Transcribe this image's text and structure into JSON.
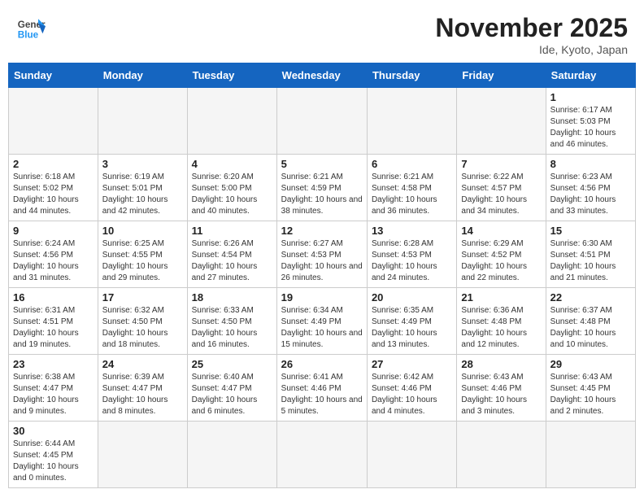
{
  "header": {
    "logo_general": "General",
    "logo_blue": "Blue",
    "title": "November 2025",
    "location": "Ide, Kyoto, Japan"
  },
  "days_of_week": [
    "Sunday",
    "Monday",
    "Tuesday",
    "Wednesday",
    "Thursday",
    "Friday",
    "Saturday"
  ],
  "weeks": [
    [
      {
        "day": "",
        "info": ""
      },
      {
        "day": "",
        "info": ""
      },
      {
        "day": "",
        "info": ""
      },
      {
        "day": "",
        "info": ""
      },
      {
        "day": "",
        "info": ""
      },
      {
        "day": "",
        "info": ""
      },
      {
        "day": "1",
        "info": "Sunrise: 6:17 AM\nSunset: 5:03 PM\nDaylight: 10 hours and 46 minutes."
      }
    ],
    [
      {
        "day": "2",
        "info": "Sunrise: 6:18 AM\nSunset: 5:02 PM\nDaylight: 10 hours and 44 minutes."
      },
      {
        "day": "3",
        "info": "Sunrise: 6:19 AM\nSunset: 5:01 PM\nDaylight: 10 hours and 42 minutes."
      },
      {
        "day": "4",
        "info": "Sunrise: 6:20 AM\nSunset: 5:00 PM\nDaylight: 10 hours and 40 minutes."
      },
      {
        "day": "5",
        "info": "Sunrise: 6:21 AM\nSunset: 4:59 PM\nDaylight: 10 hours and 38 minutes."
      },
      {
        "day": "6",
        "info": "Sunrise: 6:21 AM\nSunset: 4:58 PM\nDaylight: 10 hours and 36 minutes."
      },
      {
        "day": "7",
        "info": "Sunrise: 6:22 AM\nSunset: 4:57 PM\nDaylight: 10 hours and 34 minutes."
      },
      {
        "day": "8",
        "info": "Sunrise: 6:23 AM\nSunset: 4:56 PM\nDaylight: 10 hours and 33 minutes."
      }
    ],
    [
      {
        "day": "9",
        "info": "Sunrise: 6:24 AM\nSunset: 4:56 PM\nDaylight: 10 hours and 31 minutes."
      },
      {
        "day": "10",
        "info": "Sunrise: 6:25 AM\nSunset: 4:55 PM\nDaylight: 10 hours and 29 minutes."
      },
      {
        "day": "11",
        "info": "Sunrise: 6:26 AM\nSunset: 4:54 PM\nDaylight: 10 hours and 27 minutes."
      },
      {
        "day": "12",
        "info": "Sunrise: 6:27 AM\nSunset: 4:53 PM\nDaylight: 10 hours and 26 minutes."
      },
      {
        "day": "13",
        "info": "Sunrise: 6:28 AM\nSunset: 4:53 PM\nDaylight: 10 hours and 24 minutes."
      },
      {
        "day": "14",
        "info": "Sunrise: 6:29 AM\nSunset: 4:52 PM\nDaylight: 10 hours and 22 minutes."
      },
      {
        "day": "15",
        "info": "Sunrise: 6:30 AM\nSunset: 4:51 PM\nDaylight: 10 hours and 21 minutes."
      }
    ],
    [
      {
        "day": "16",
        "info": "Sunrise: 6:31 AM\nSunset: 4:51 PM\nDaylight: 10 hours and 19 minutes."
      },
      {
        "day": "17",
        "info": "Sunrise: 6:32 AM\nSunset: 4:50 PM\nDaylight: 10 hours and 18 minutes."
      },
      {
        "day": "18",
        "info": "Sunrise: 6:33 AM\nSunset: 4:50 PM\nDaylight: 10 hours and 16 minutes."
      },
      {
        "day": "19",
        "info": "Sunrise: 6:34 AM\nSunset: 4:49 PM\nDaylight: 10 hours and 15 minutes."
      },
      {
        "day": "20",
        "info": "Sunrise: 6:35 AM\nSunset: 4:49 PM\nDaylight: 10 hours and 13 minutes."
      },
      {
        "day": "21",
        "info": "Sunrise: 6:36 AM\nSunset: 4:48 PM\nDaylight: 10 hours and 12 minutes."
      },
      {
        "day": "22",
        "info": "Sunrise: 6:37 AM\nSunset: 4:48 PM\nDaylight: 10 hours and 10 minutes."
      }
    ],
    [
      {
        "day": "23",
        "info": "Sunrise: 6:38 AM\nSunset: 4:47 PM\nDaylight: 10 hours and 9 minutes."
      },
      {
        "day": "24",
        "info": "Sunrise: 6:39 AM\nSunset: 4:47 PM\nDaylight: 10 hours and 8 minutes."
      },
      {
        "day": "25",
        "info": "Sunrise: 6:40 AM\nSunset: 4:47 PM\nDaylight: 10 hours and 6 minutes."
      },
      {
        "day": "26",
        "info": "Sunrise: 6:41 AM\nSunset: 4:46 PM\nDaylight: 10 hours and 5 minutes."
      },
      {
        "day": "27",
        "info": "Sunrise: 6:42 AM\nSunset: 4:46 PM\nDaylight: 10 hours and 4 minutes."
      },
      {
        "day": "28",
        "info": "Sunrise: 6:43 AM\nSunset: 4:46 PM\nDaylight: 10 hours and 3 minutes."
      },
      {
        "day": "29",
        "info": "Sunrise: 6:43 AM\nSunset: 4:45 PM\nDaylight: 10 hours and 2 minutes."
      }
    ],
    [
      {
        "day": "30",
        "info": "Sunrise: 6:44 AM\nSunset: 4:45 PM\nDaylight: 10 hours and 0 minutes."
      },
      {
        "day": "",
        "info": ""
      },
      {
        "day": "",
        "info": ""
      },
      {
        "day": "",
        "info": ""
      },
      {
        "day": "",
        "info": ""
      },
      {
        "day": "",
        "info": ""
      },
      {
        "day": "",
        "info": ""
      }
    ]
  ]
}
